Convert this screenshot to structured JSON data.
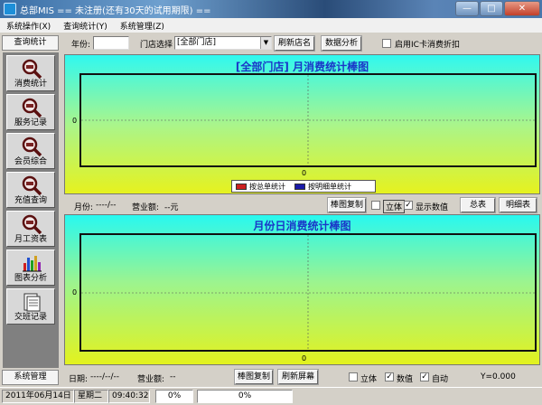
{
  "window": {
    "title": "总部MIS  == 未注册(还有30天的试用期限) ==",
    "min_label": "—",
    "max_label": "□",
    "close_label": "✕"
  },
  "menu": [
    "系统操作(X)",
    "查询统计(Y)",
    "系统管理(Z)"
  ],
  "left_panel": {
    "header": "查询统计",
    "footer": "系统管理",
    "nav": [
      {
        "label": "消费统计",
        "icon": "magnifier-icon"
      },
      {
        "label": "服务记录",
        "icon": "magnifier-icon"
      },
      {
        "label": "会员综合",
        "icon": "magnifier-icon"
      },
      {
        "label": "充值查询",
        "icon": "magnifier-icon"
      },
      {
        "label": "月工资表",
        "icon": "magnifier-icon"
      },
      {
        "label": "图表分析",
        "icon": "bar-chart-icon"
      },
      {
        "label": "交班记录",
        "icon": "document-icon"
      }
    ]
  },
  "toolbar": {
    "year_label": "年份:",
    "year_value": "",
    "store_label": "门店选择",
    "store_value": "[全部门店]",
    "refresh_store_btn": "刷新店名",
    "analyze_btn": "数据分析",
    "ic_discount_label": "启用IC卡消费折扣",
    "ic_discount_checked": false
  },
  "chart_data": [
    {
      "type": "bar",
      "title": "[全部门店] 月消费统计棒图",
      "categories": [],
      "series": [],
      "y_tick": "0",
      "x_tick": "0",
      "legend_entries": [
        "按总单统计",
        "按明细单统计"
      ],
      "colors": {
        "series1": "#cc2020",
        "series2": "#1a1aa8",
        "bg_top": "#30f8f0",
        "bg_bottom": "#e6f21e"
      }
    },
    {
      "type": "bar",
      "title": "月份日消费统计棒图",
      "categories": [],
      "series": [],
      "y_tick": "0",
      "x_tick": "0"
    }
  ],
  "mid_bar": {
    "month_label": "月份:",
    "month_value": "----/--",
    "revenue_label": "营业额:",
    "revenue_value": "--元",
    "copy_btn": "棒图复制",
    "stereo_label": "立体",
    "stereo_checked": false,
    "show_values_label": "显示数值",
    "show_values_checked": true,
    "summary_btn": "总表",
    "detail_btn": "明细表"
  },
  "bottom_bar": {
    "date_label": "日期:",
    "date_value": "----/--/--",
    "revenue_label": "营业额:",
    "revenue_value": "--",
    "copy_btn": "棒图复制",
    "refresh_btn": "刷新屏幕",
    "stereo_label": "立体",
    "stereo_checked": false,
    "values_label": "数值",
    "values_checked": true,
    "auto_label": "自动",
    "auto_checked": true,
    "y_readout": "Y=0.000"
  },
  "status": {
    "date": "2011年06月14日",
    "weekday": "星期二",
    "time": "09:40:32",
    "progress1": "0%",
    "progress2": "0%"
  }
}
